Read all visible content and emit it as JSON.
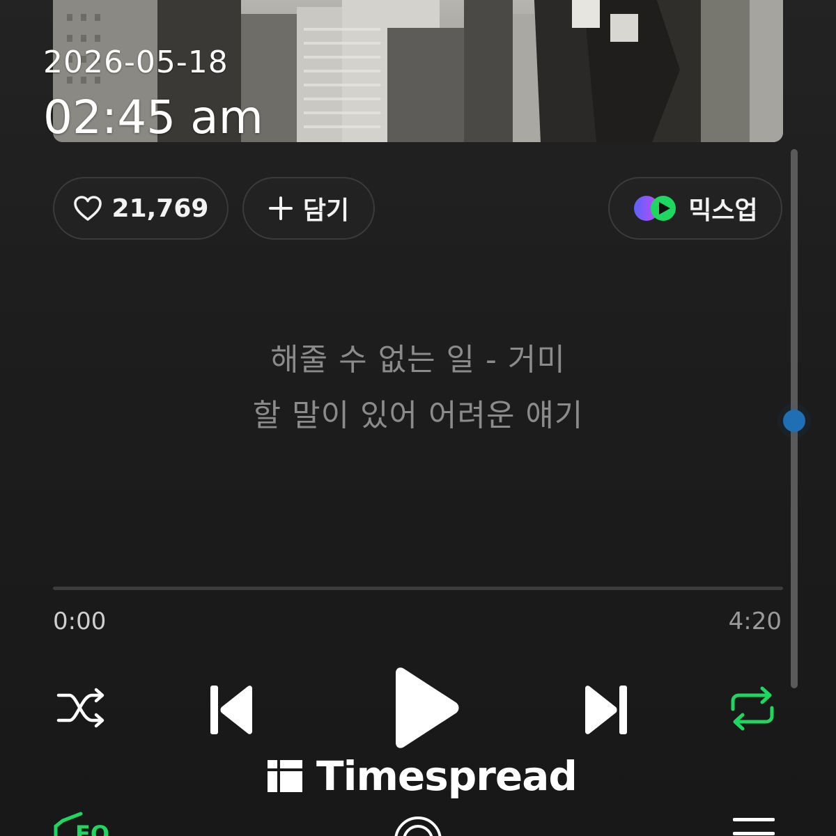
{
  "overlay": {
    "date": "2026-05-18",
    "time": "02:45 am"
  },
  "actions": {
    "like_count": "21,769",
    "add_label": "담기",
    "mixup_label": "믹스업"
  },
  "lyrics": {
    "line1": "해줄 수 없는 일 - 거미",
    "line2": "할 말이 있어 어려운 얘기"
  },
  "playback": {
    "elapsed": "0:00",
    "total": "4:20",
    "progress": 0
  },
  "controls": {
    "shuffle_icon": "shuffle-icon",
    "prev_icon": "skip-previous-icon",
    "play_icon": "play-icon",
    "next_icon": "skip-next-icon",
    "repeat_icon": "repeat-icon",
    "repeat_active": true
  },
  "bottom_bar": {
    "eq_label": "EQ"
  },
  "watermark": {
    "text": "Timespread"
  },
  "colors": {
    "accent_green": "#1ed760",
    "scroll_thumb": "#1f6fb5",
    "lyric_text": "#8b8b8b"
  }
}
